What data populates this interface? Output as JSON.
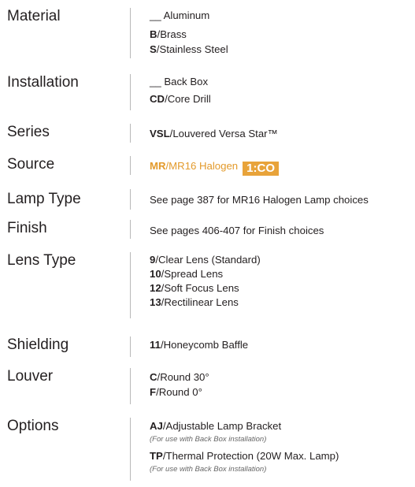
{
  "colors": {
    "text": "#231f20",
    "accent": "#e39a2b",
    "divider": "#b9b9b9"
  },
  "sections": {
    "material": {
      "label": "Material",
      "options": [
        {
          "code": "__",
          "desc": " Aluminum"
        },
        {
          "code": "B",
          "desc": "/Brass"
        },
        {
          "code": "S",
          "desc": "/Stainless Steel"
        }
      ]
    },
    "installation": {
      "label": "Installation",
      "options": [
        {
          "code": "__",
          "desc": " Back Box"
        },
        {
          "code": "CD",
          "desc": "/Core Drill"
        }
      ]
    },
    "series": {
      "label": "Series",
      "options": [
        {
          "code": "VSL",
          "desc": "/Louvered Versa Star™"
        }
      ]
    },
    "source": {
      "label": "Source",
      "options": [
        {
          "code": "MR",
          "desc": "/MR16 Halogen"
        }
      ],
      "badge": "1:CO"
    },
    "lamp_type": {
      "label": "Lamp Type",
      "text": "See page 387 for MR16 Halogen Lamp choices"
    },
    "finish": {
      "label": "Finish",
      "text": "See pages 406-407 for Finish choices"
    },
    "lens_type": {
      "label": "Lens Type",
      "options": [
        {
          "code": "9",
          "desc": "/Clear Lens (Standard)"
        },
        {
          "code": "10",
          "desc": "/Spread Lens"
        },
        {
          "code": "12",
          "desc": "/Soft Focus Lens"
        },
        {
          "code": "13",
          "desc": "/Rectilinear Lens"
        }
      ]
    },
    "shielding": {
      "label": "Shielding",
      "options": [
        {
          "code": "11",
          "desc": "/Honeycomb Baffle"
        }
      ]
    },
    "louver": {
      "label": "Louver",
      "options": [
        {
          "code": "C",
          "desc": "/Round 30°"
        },
        {
          "code": "F",
          "desc": "/Round 0°"
        }
      ]
    },
    "options": {
      "label": "Options",
      "options": [
        {
          "code": "AJ",
          "desc": "/Adjustable Lamp Bracket",
          "note": "(For use with Back Box installation)"
        },
        {
          "code": "TP",
          "desc": "/Thermal Protection (20W Max. Lamp)",
          "note": "(For use with Back Box installation)"
        }
      ]
    }
  }
}
